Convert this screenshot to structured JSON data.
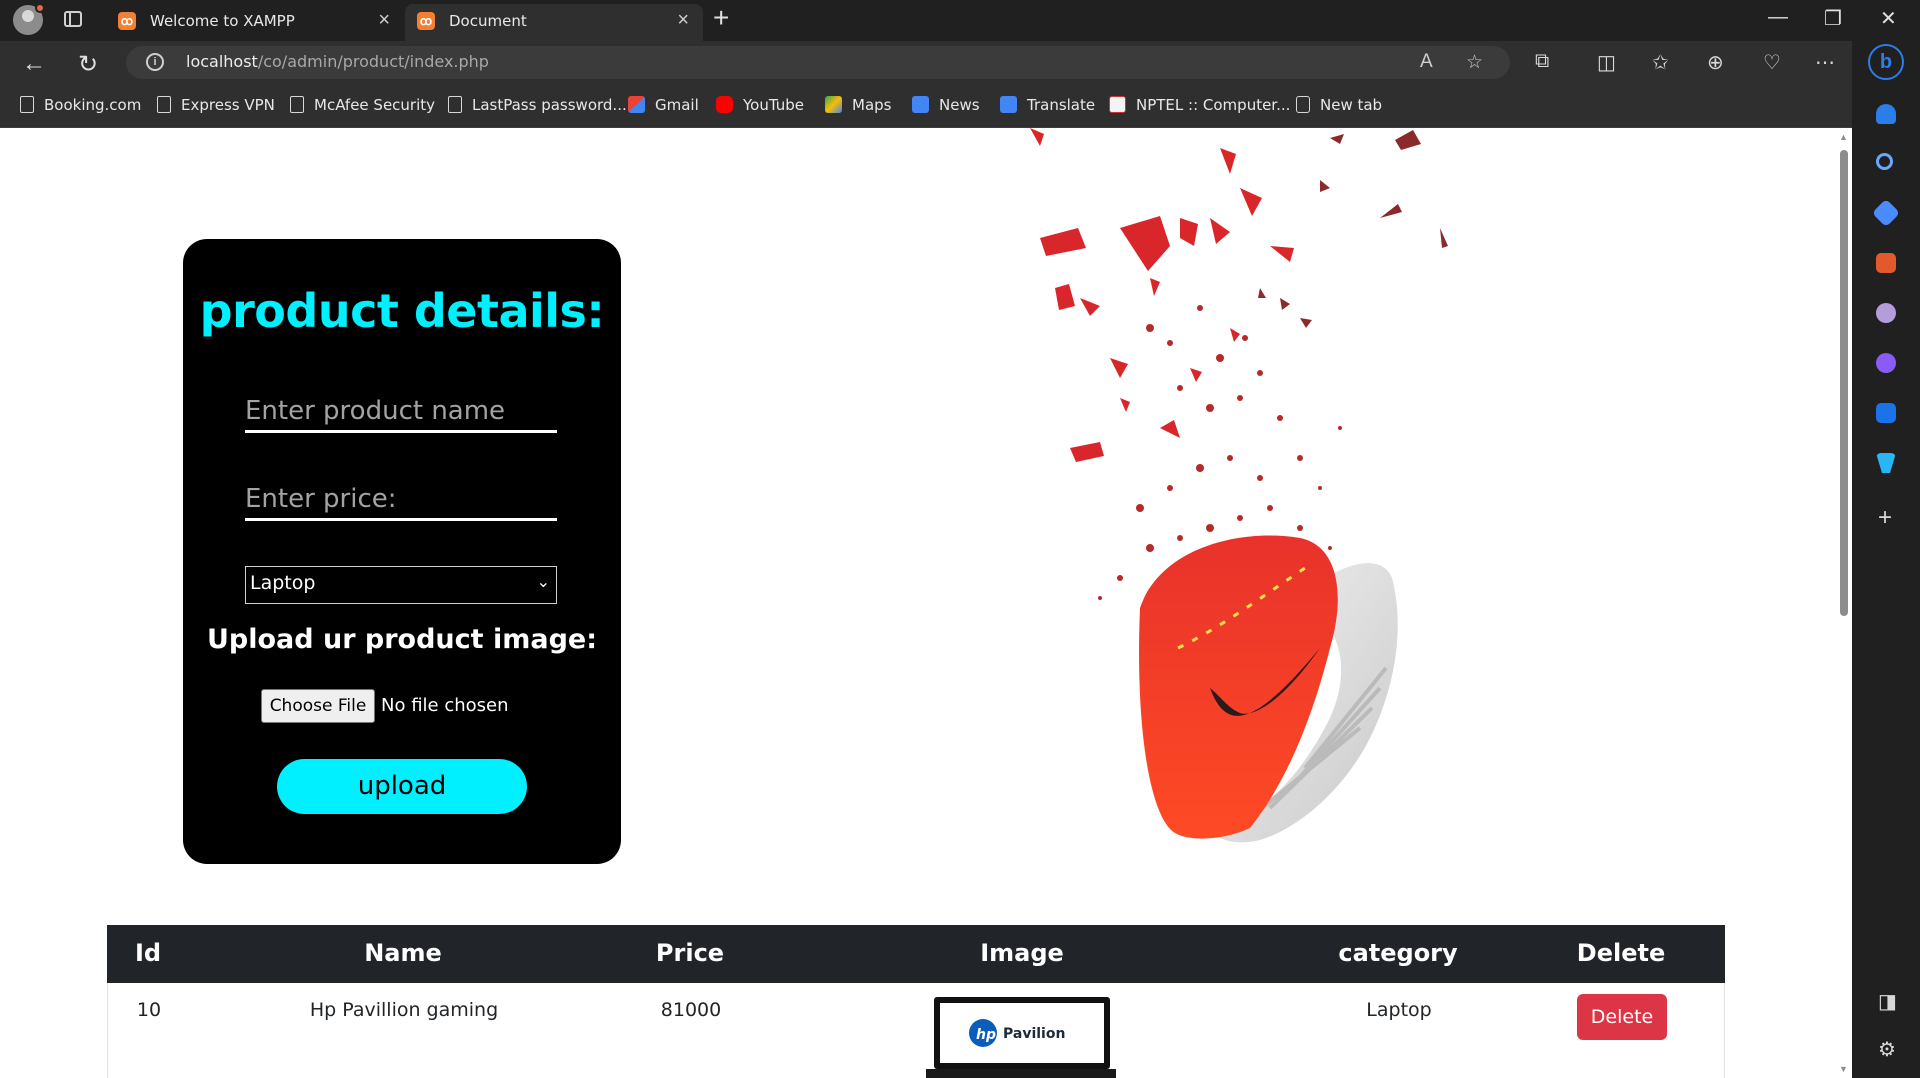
{
  "browser": {
    "tabs": [
      {
        "title": "Welcome to XAMPP",
        "active": false
      },
      {
        "title": "Document",
        "active": true
      }
    ],
    "url_host": "localhost",
    "url_path": "/co/admin/product/index.php",
    "bookmarks": [
      {
        "label": "Booking.com",
        "icon": "page-icon"
      },
      {
        "label": "Express VPN",
        "icon": "page-icon"
      },
      {
        "label": "McAfee Security",
        "icon": "page-icon"
      },
      {
        "label": "LastPass password...",
        "icon": "page-icon"
      },
      {
        "label": "Gmail",
        "icon": "gmail-icon"
      },
      {
        "label": "YouTube",
        "icon": "youtube-icon"
      },
      {
        "label": "Maps",
        "icon": "maps-icon"
      },
      {
        "label": "News",
        "icon": "news-icon"
      },
      {
        "label": "Translate",
        "icon": "translate-icon"
      },
      {
        "label": "NPTEL :: Computer...",
        "icon": "nptel-icon"
      },
      {
        "label": "New tab",
        "icon": "newtab-icon"
      }
    ]
  },
  "form": {
    "title": "product details:",
    "name_placeholder": "Enter product name",
    "price_placeholder": "Enter price:",
    "category_selected": "Laptop",
    "upload_label": "Upload ur product image:",
    "file_button": "Choose File",
    "file_status": "No file chosen",
    "submit_label": "upload"
  },
  "table": {
    "headers": [
      "Id",
      "Name",
      "Price",
      "Image",
      "category",
      "Delete"
    ],
    "rows": [
      {
        "id": "10",
        "name": "Hp Pavillion gaming",
        "price": "81000",
        "image_text": "Pavilion",
        "category": "Laptop",
        "delete_label": "Delete"
      }
    ]
  },
  "colors": {
    "accent": "#00f0ff",
    "delete": "#dc3545",
    "table_header": "#212529"
  }
}
